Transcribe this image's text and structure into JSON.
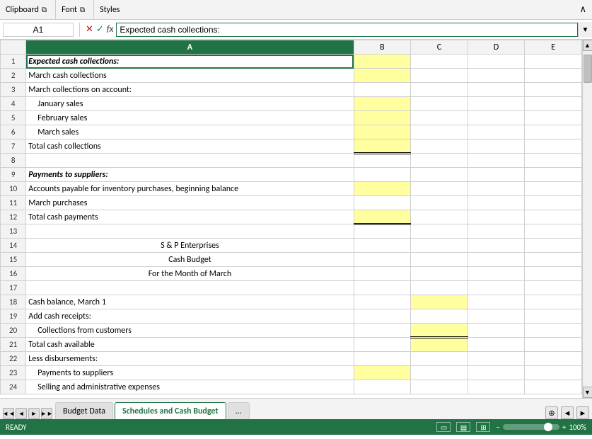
{
  "toolbar": {
    "clipboard_label": "Clipboard",
    "font_label": "Font",
    "styles_label": "Styles"
  },
  "formula_bar": {
    "cell_ref": "A1",
    "formula_text": "Expected cash collections:",
    "fx_label": "fx"
  },
  "columns": {
    "headers": [
      "",
      "A",
      "B",
      "C",
      "D",
      "E"
    ]
  },
  "rows": [
    {
      "row": 1,
      "a": "Expected cash collections:",
      "a_style": "bold-italic selected",
      "b": "",
      "b_style": "yellow",
      "c": "",
      "d": "",
      "e": ""
    },
    {
      "row": 2,
      "a": "March cash collections",
      "b": "",
      "b_style": "yellow",
      "c": "",
      "d": "",
      "e": ""
    },
    {
      "row": 3,
      "a": "March collections on account:",
      "b": "",
      "b_style": "no-yellow",
      "c": "",
      "d": "",
      "e": ""
    },
    {
      "row": 4,
      "a": "January sales",
      "a_style": "indent",
      "b": "",
      "b_style": "yellow",
      "c": "",
      "d": "",
      "e": ""
    },
    {
      "row": 5,
      "a": "February sales",
      "a_style": "indent",
      "b": "",
      "b_style": "yellow",
      "c": "",
      "d": "",
      "e": ""
    },
    {
      "row": 6,
      "a": "March sales",
      "a_style": "indent",
      "b": "",
      "b_style": "yellow",
      "c": "",
      "d": "",
      "e": ""
    },
    {
      "row": 7,
      "a": "Total cash collections",
      "b": "",
      "b_style": "yellow double-underline",
      "c": "",
      "d": "",
      "e": ""
    },
    {
      "row": 8,
      "a": "",
      "b": "",
      "b_style": "no-yellow",
      "c": "",
      "d": "",
      "e": ""
    },
    {
      "row": 9,
      "a": "Payments to suppliers:",
      "a_style": "bold-italic",
      "b": "",
      "b_style": "no-yellow",
      "c": "",
      "d": "",
      "e": ""
    },
    {
      "row": 10,
      "a": "Accounts payable for inventory purchases, beginning balance",
      "b": "",
      "b_style": "yellow",
      "c": "",
      "d": "",
      "e": ""
    },
    {
      "row": 11,
      "a": "March purchases",
      "b": "",
      "b_style": "no-yellow",
      "c": "",
      "d": "",
      "e": ""
    },
    {
      "row": 12,
      "a": "Total cash payments",
      "b": "",
      "b_style": "yellow double-underline",
      "c": "",
      "d": "",
      "e": ""
    },
    {
      "row": 13,
      "a": "",
      "b": "",
      "b_style": "no-yellow",
      "c": "",
      "d": "",
      "e": ""
    },
    {
      "row": 14,
      "a": "S & P Enterprises",
      "a_style": "center",
      "b": "",
      "b_style": "no-yellow",
      "c": "",
      "d": "",
      "e": ""
    },
    {
      "row": 15,
      "a": "Cash Budget",
      "a_style": "center",
      "b": "",
      "b_style": "no-yellow",
      "c": "",
      "d": "",
      "e": ""
    },
    {
      "row": 16,
      "a": "For the Month of March",
      "a_style": "center",
      "b": "",
      "b_style": "no-yellow",
      "c": "",
      "d": "",
      "e": ""
    },
    {
      "row": 17,
      "a": "",
      "b": "",
      "b_style": "no-yellow",
      "c": "",
      "d": "",
      "e": ""
    },
    {
      "row": 18,
      "a": "Cash balance, March 1",
      "b": "",
      "b_style": "no-yellow",
      "c": "",
      "c_style": "yellow",
      "d": "",
      "e": ""
    },
    {
      "row": 19,
      "a": "Add cash receipts:",
      "b": "",
      "b_style": "no-yellow",
      "c": "",
      "c_style": "no-yellow",
      "d": "",
      "e": ""
    },
    {
      "row": 20,
      "a": "Collections from customers",
      "a_style": "indent",
      "b": "",
      "b_style": "no-yellow",
      "c": "",
      "c_style": "yellow double-underline",
      "d": "",
      "e": ""
    },
    {
      "row": 21,
      "a": "Total cash available",
      "b": "",
      "b_style": "no-yellow",
      "c": "",
      "c_style": "yellow",
      "d": "",
      "e": ""
    },
    {
      "row": 22,
      "a": "Less disbursements:",
      "b": "",
      "b_style": "no-yellow",
      "c": "",
      "c_style": "no-yellow",
      "d": "",
      "e": ""
    },
    {
      "row": 23,
      "a": "Payments to suppliers",
      "a_style": "indent",
      "b": "",
      "b_style": "yellow",
      "c": "",
      "c_style": "no-yellow",
      "d": "",
      "e": ""
    },
    {
      "row": 24,
      "a": "Selling and administrative expenses",
      "a_style": "indent",
      "b": "",
      "b_style": "no-yellow",
      "c": "",
      "c_style": "no-yellow",
      "d": "",
      "e": ""
    }
  ],
  "tabs": [
    {
      "label": "◄",
      "type": "nav"
    },
    {
      "label": "►",
      "type": "nav"
    },
    {
      "label": "...",
      "type": "nav"
    },
    {
      "label": "Budget Data",
      "type": "tab",
      "active": false
    },
    {
      "label": "Schedules and Cash Budget",
      "type": "tab",
      "active": true
    },
    {
      "label": "...",
      "type": "more"
    }
  ],
  "status": {
    "ready": "READY"
  },
  "zoom": "100%"
}
